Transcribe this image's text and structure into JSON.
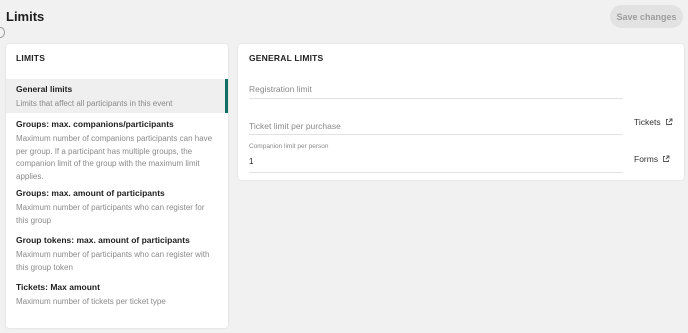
{
  "page": {
    "title": "Limits"
  },
  "toolbar": {
    "save_label": "Save changes"
  },
  "left_panel": {
    "heading": "LIMITS",
    "items": [
      {
        "title": "General limits",
        "description": "Limits that affect all participants in this event"
      },
      {
        "title": "Groups: max. companions/participants",
        "description": "Maximum number of companions participants can have per group. If a participant has multiple groups, the companion limit of the group with the maximum limit applies."
      },
      {
        "title": "Groups: max. amount of participants",
        "description": "Maximum number of participants who can register for this group"
      },
      {
        "title": "Group tokens: max. amount of participants",
        "description": "Maximum number of participants who can register with this group token"
      },
      {
        "title": "Tickets: Max amount",
        "description": "Maximum number of tickets per ticket type"
      }
    ]
  },
  "right_panel": {
    "heading": "GENERAL LIMITS",
    "registration_limit": {
      "label": "Registration limit"
    },
    "ticket_limit": {
      "label": "Ticket limit per purchase",
      "link": "Tickets"
    },
    "companion_limit": {
      "label": "Companion limit per person",
      "value": "1",
      "link": "Forms"
    }
  },
  "icons": {
    "link": "external-link-icon"
  }
}
